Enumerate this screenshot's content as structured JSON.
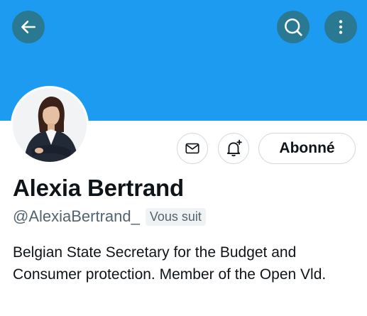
{
  "header": {
    "back_icon": "arrow-left-icon",
    "search_icon": "search-icon",
    "more_icon": "more-vertical-icon",
    "banner_color": "#1d9bf0"
  },
  "profile": {
    "name": "Alexia Bertrand",
    "handle": "@AlexiaBertrand_",
    "follows_you": "Vous suit",
    "bio": "Belgian State Secretary for the Budget and Consumer protection. Member of the Open Vld."
  },
  "actions": {
    "message_icon": "mail-icon",
    "notify_icon": "bell-plus-icon",
    "follow_label": "Abonné"
  }
}
